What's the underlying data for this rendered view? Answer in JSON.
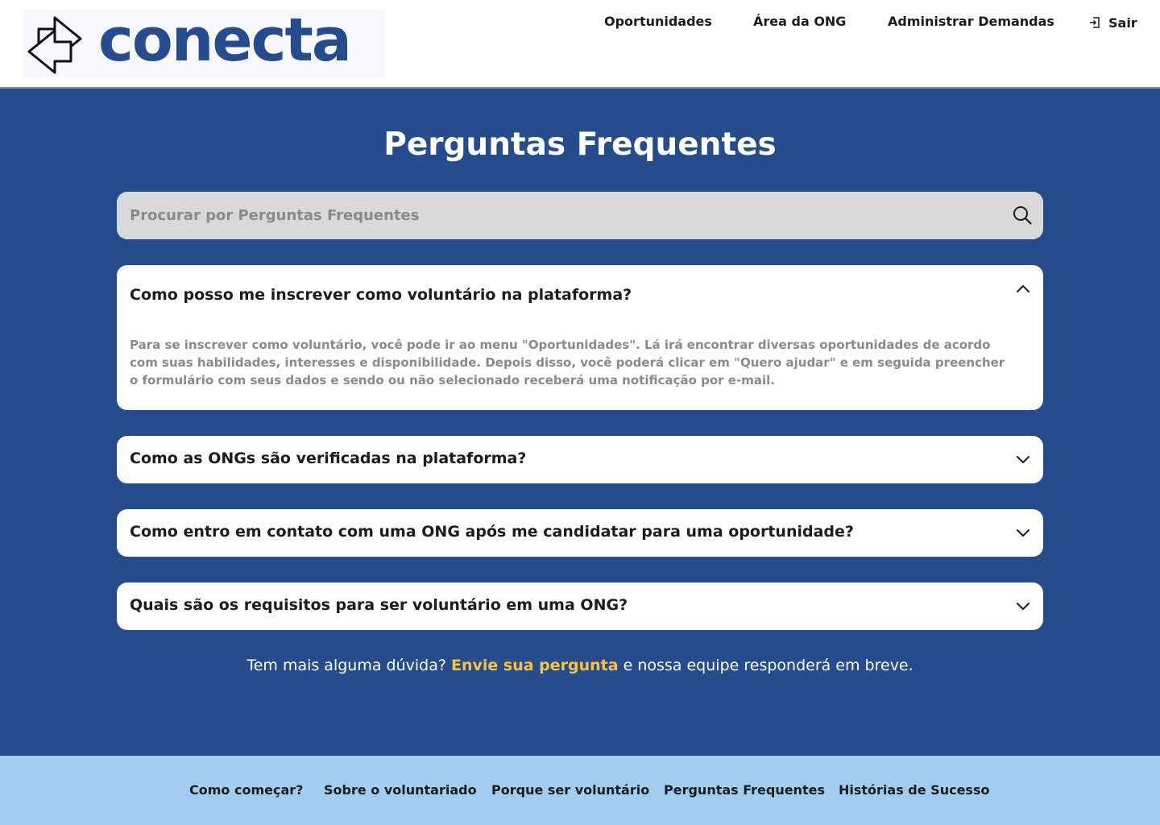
{
  "brand": {
    "name": "conecta",
    "color": "#274c8d"
  },
  "nav": {
    "opportunities": "Oportunidades",
    "ong_area": "Área da ONG",
    "manage_demands": "Administrar Demandas",
    "logout": "Sair"
  },
  "main": {
    "title": "Perguntas Frequentes",
    "search": {
      "placeholder": "Procurar por Perguntas Frequentes",
      "value": ""
    },
    "faqs": [
      {
        "question": "Como posso me inscrever como voluntário na plataforma?",
        "answer": "Para se inscrever como voluntário, você pode ir ao menu \"Oportunidades\". Lá irá encontrar diversas oportunidades de acordo com suas habilidades, interesses e disponibilidade. Depois disso, você poderá clicar em \"Quero ajudar\" e em seguida preencher o formulário com seus dados e sendo ou não selecionado receberá uma notificação por e-mail.",
        "expanded": true
      },
      {
        "question": "Como as ONGs são verificadas na plataforma?",
        "expanded": false
      },
      {
        "question": "Como entro em contato com uma ONG após me candidatar para uma oportunidade?",
        "expanded": false
      },
      {
        "question": "Quais são os requisitos para ser voluntário em uma ONG?",
        "expanded": false
      }
    ],
    "more": {
      "prefix": "Tem mais alguma dúvida? ",
      "link": "Envie sua pergunta",
      "suffix": " e nossa equipe responderá em breve."
    }
  },
  "footer": {
    "links": [
      "Como começar?",
      "Sobre o voluntariado",
      "Porque ser voluntário",
      "Perguntas Frequentes",
      "Histórias de Sucesso"
    ]
  },
  "colors": {
    "primary_bg": "#274c8d",
    "accent": "#f6c343",
    "footer_bg": "#a3cdf0",
    "search_bg": "#d9d9d9"
  },
  "icons": {
    "logo": "arrows-exchange-icon",
    "logout": "logout-icon",
    "search": "search-icon",
    "expanded": "chevron-up-icon",
    "collapsed": "chevron-down-icon"
  }
}
